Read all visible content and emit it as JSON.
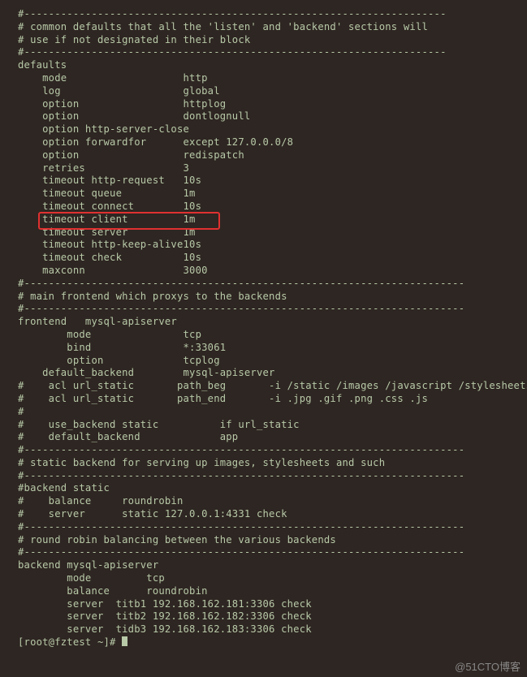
{
  "config": {
    "divider_short": "#---------------------------------------------------------------------",
    "divider_long": "#------------------------------------------------------------------------",
    "comment_defaults_1": "# common defaults that all the 'listen' and 'backend' sections will",
    "comment_defaults_2": "# use if not designated in their block",
    "section_defaults": "defaults",
    "defaults": [
      [
        "    mode",
        "http"
      ],
      [
        "    log",
        "global"
      ],
      [
        "    option",
        "httplog"
      ],
      [
        "    option",
        "dontlognull"
      ],
      [
        "    option http-server-close",
        ""
      ],
      [
        "    option forwardfor",
        "except 127.0.0.0/8"
      ],
      [
        "    option",
        "redispatch"
      ],
      [
        "    retries",
        "3"
      ],
      [
        "    timeout http-request",
        "10s"
      ],
      [
        "    timeout queue",
        "1m"
      ],
      [
        "    timeout connect",
        "10s"
      ],
      [
        "    timeout client",
        "1m"
      ],
      [
        "    timeout server",
        "1m"
      ],
      [
        "    timeout http-keep-alive",
        "10s"
      ],
      [
        "    timeout check",
        "10s"
      ],
      [
        "    maxconn",
        "3000"
      ]
    ],
    "highlight_index": 11,
    "comment_frontend": "# main frontend which proxys to the backends",
    "section_frontend": "frontend   mysql-apiserver",
    "frontend": [
      [
        "        mode",
        "tcp"
      ],
      [
        "        bind",
        "*:33061"
      ],
      [
        "        option",
        "tcplog"
      ],
      [
        "    default_backend",
        "mysql-apiserver"
      ]
    ],
    "acl1": "#    acl url_static       path_beg       -i /static /images /javascript /stylesheets",
    "acl2": "#    acl url_static       path_end       -i .jpg .gif .png .css .js",
    "hash": "#",
    "use_backend": "#    use_backend static          if url_static",
    "default_backend": "#    default_backend             app",
    "comment_static_1": "# static backend for serving up images, stylesheets and such",
    "backend_static": "#backend static",
    "static_balance": "#    balance     roundrobin",
    "static_server": "#    server      static 127.0.0.1:4331 check",
    "comment_rr": "# round robin balancing between the various backends",
    "section_backend": "backend mysql-apiserver",
    "backend": [
      [
        "        mode",
        "tcp"
      ],
      [
        "        balance",
        "roundrobin"
      ]
    ],
    "servers": [
      "        server  titb1 192.168.162.181:3306 check",
      "        server  titb2 192.168.162.182:3306 check",
      "        server  tidb3 192.168.162.183:3306 check"
    ],
    "prompt": "[root@fztest ~]# "
  },
  "watermark": "@51CTO博客"
}
